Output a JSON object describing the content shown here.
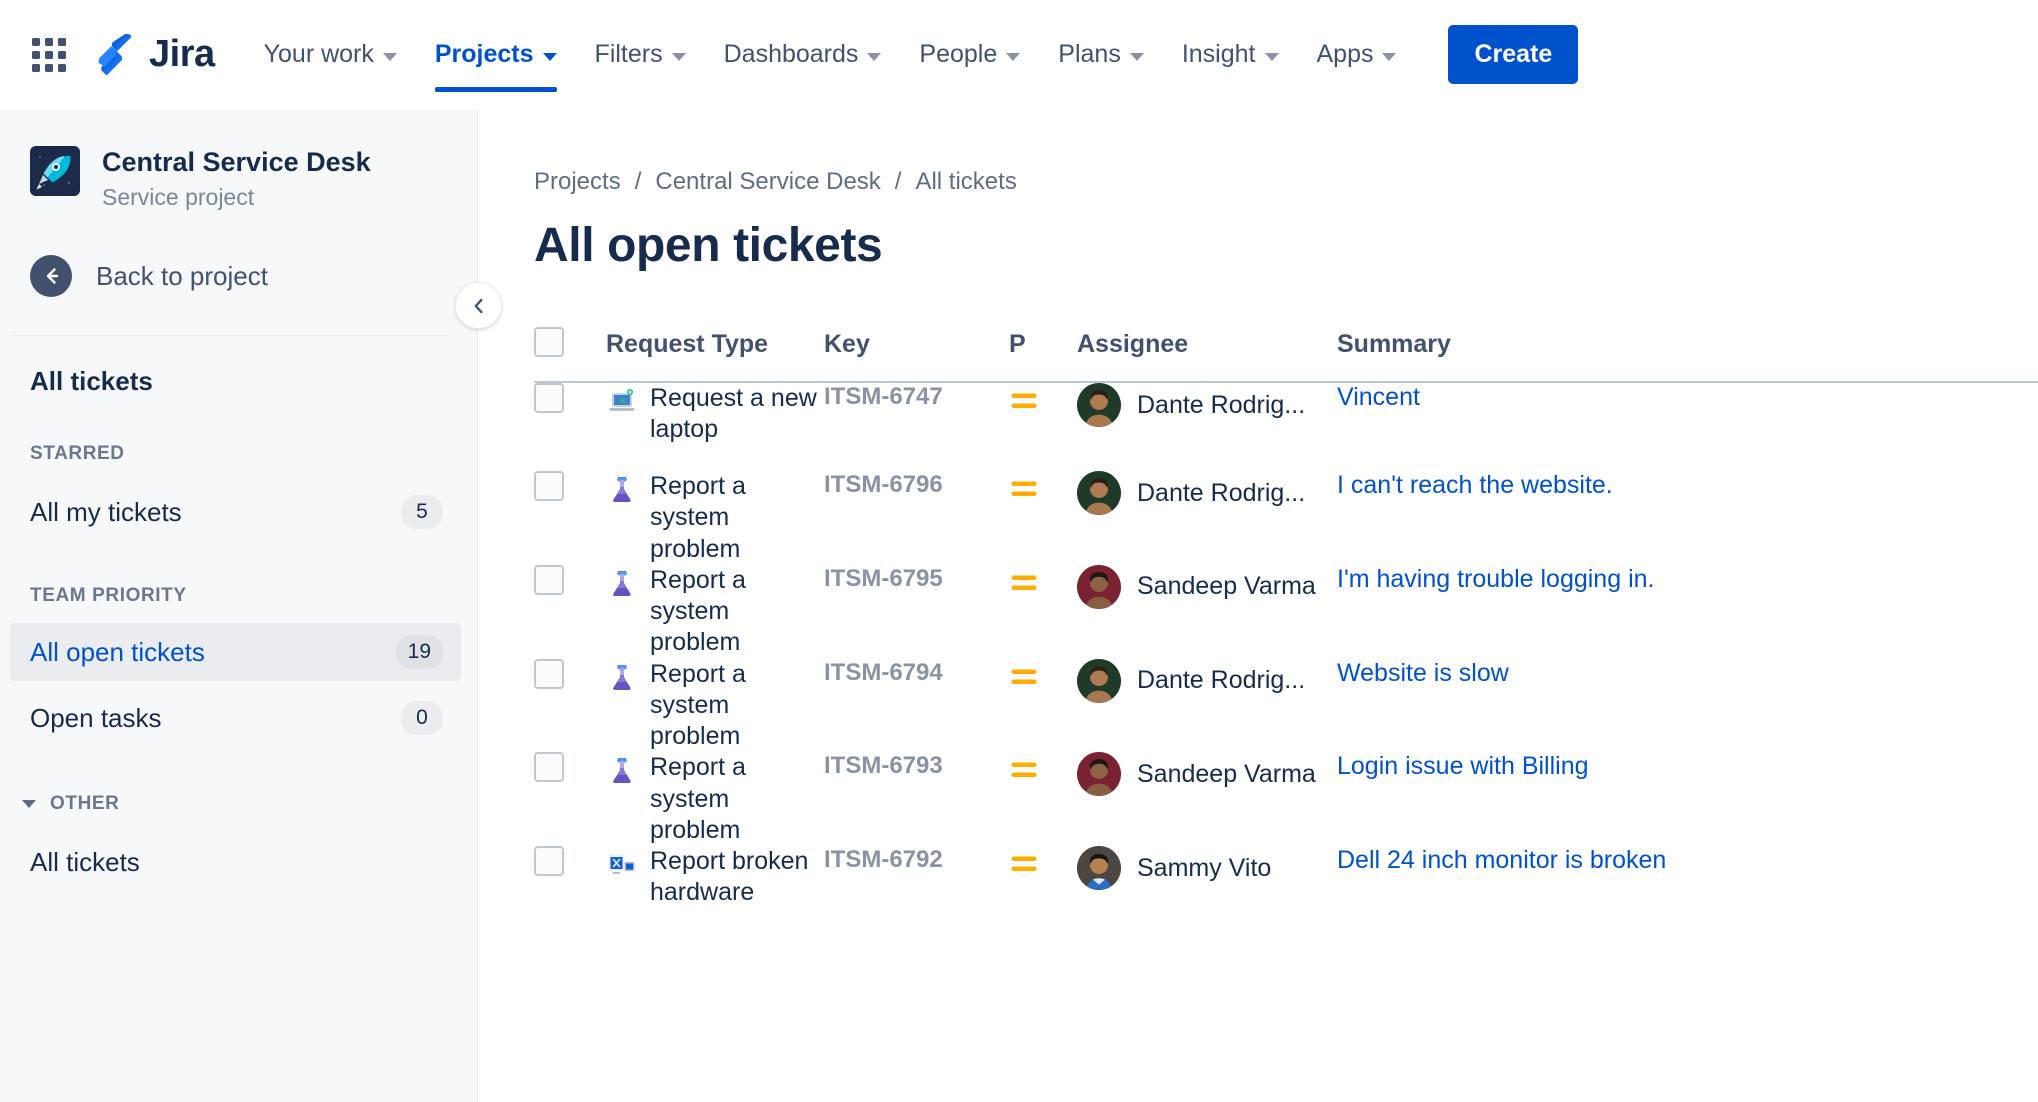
{
  "topnav": {
    "app_switcher_icon": "grid-apps-icon",
    "brand": "Jira",
    "items": [
      {
        "label": "Your work",
        "has_chevron": true,
        "active": false
      },
      {
        "label": "Projects",
        "has_chevron": true,
        "active": true
      },
      {
        "label": "Filters",
        "has_chevron": true,
        "active": false
      },
      {
        "label": "Dashboards",
        "has_chevron": true,
        "active": false
      },
      {
        "label": "People",
        "has_chevron": true,
        "active": false
      },
      {
        "label": "Plans",
        "has_chevron": true,
        "active": false
      },
      {
        "label": "Insight",
        "has_chevron": true,
        "active": false
      },
      {
        "label": "Apps",
        "has_chevron": true,
        "active": false
      }
    ],
    "create_label": "Create"
  },
  "sidebar": {
    "project_name": "Central Service Desk",
    "project_type": "Service project",
    "project_avatar_icon": "rocket-icon",
    "back_label": "Back to project",
    "back_icon": "arrow-left-icon",
    "all_tickets_heading": "All tickets",
    "sections": [
      {
        "label": "STARRED",
        "collapsible": false,
        "items": [
          {
            "label": "All my tickets",
            "count": "5",
            "selected": false
          }
        ]
      },
      {
        "label": "TEAM PRIORITY",
        "collapsible": false,
        "items": [
          {
            "label": "All open tickets",
            "count": "19",
            "selected": true
          },
          {
            "label": "Open tasks",
            "count": "0",
            "selected": false
          }
        ]
      },
      {
        "label": "OTHER",
        "collapsible": true,
        "items": [
          {
            "label": "All tickets",
            "count": "",
            "selected": false
          }
        ]
      }
    ],
    "collapse_icon": "chevron-left-icon"
  },
  "main": {
    "breadcrumb": [
      {
        "label": "Projects"
      },
      {
        "label": "Central Service Desk"
      },
      {
        "label": "All tickets"
      }
    ],
    "breadcrumb_separator": "/",
    "page_title": "All open tickets",
    "table": {
      "columns": [
        {
          "key": "check",
          "label": ""
        },
        {
          "key": "type",
          "label": "Request Type"
        },
        {
          "key": "key",
          "label": "Key"
        },
        {
          "key": "priority",
          "label": "P"
        },
        {
          "key": "assignee",
          "label": "Assignee"
        },
        {
          "key": "summary",
          "label": "Summary"
        }
      ],
      "rows": [
        {
          "request_type": "Request a new laptop",
          "type_icon": "laptop-icon",
          "key": "ITSM-6747",
          "priority": "Medium",
          "priority_icon": "priority-medium-icon",
          "assignee": "Dante Rodrig...",
          "avatar_bg": "#1F3A28",
          "summary": "Vincent"
        },
        {
          "request_type": "Report a system problem",
          "type_icon": "flask-icon",
          "key": "ITSM-6796",
          "priority": "Medium",
          "priority_icon": "priority-medium-icon",
          "assignee": "Dante Rodrig...",
          "avatar_bg": "#1F3A28",
          "summary": "I can't reach the website."
        },
        {
          "request_type": "Report a system problem",
          "type_icon": "flask-icon",
          "key": "ITSM-6795",
          "priority": "Medium",
          "priority_icon": "priority-medium-icon",
          "assignee": "Sandeep Varma",
          "avatar_bg": "#7A2231",
          "summary": "I'm having trouble logging in."
        },
        {
          "request_type": "Report a system problem",
          "type_icon": "flask-icon",
          "key": "ITSM-6794",
          "priority": "Medium",
          "priority_icon": "priority-medium-icon",
          "assignee": "Dante Rodrig...",
          "avatar_bg": "#1F3A28",
          "summary": "Website is slow"
        },
        {
          "request_type": "Report a system problem",
          "type_icon": "flask-icon",
          "key": "ITSM-6793",
          "priority": "Medium",
          "priority_icon": "priority-medium-icon",
          "assignee": "Sandeep Varma",
          "avatar_bg": "#7A2231",
          "summary": "Login issue with Billing"
        },
        {
          "request_type": "Report broken hardware",
          "type_icon": "monitor-icon",
          "key": "ITSM-6792",
          "priority": "Medium",
          "priority_icon": "priority-medium-icon",
          "assignee": "Sammy Vito",
          "avatar_bg": "#2E2A26",
          "summary": "Dell 24 inch monitor is broken"
        }
      ]
    }
  },
  "colors": {
    "brand_blue": "#0052CC",
    "link_blue": "#0052CC",
    "text_dark": "#172B4D",
    "text_muted": "#5E6C84",
    "key_muted": "#8993A4",
    "priority_medium": "#FFAB00",
    "sidebar_bg": "#F7F8F9",
    "selected_bg": "#EBECF0"
  }
}
